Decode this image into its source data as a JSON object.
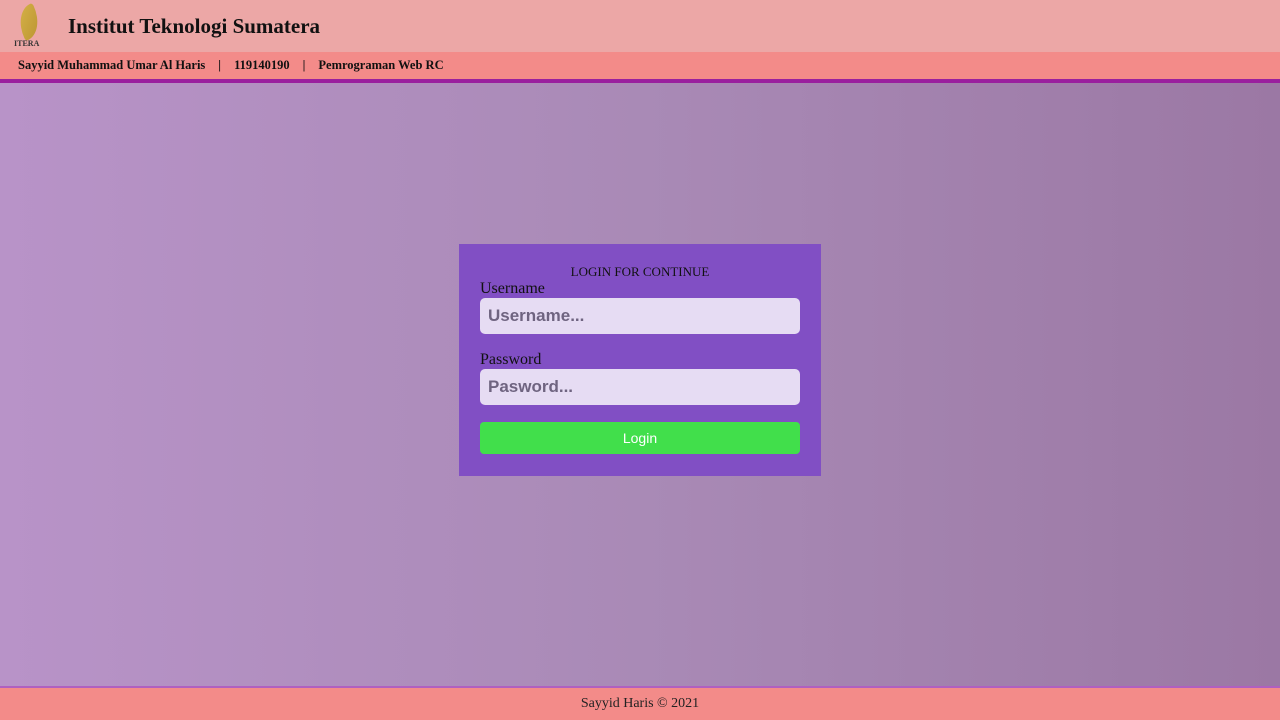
{
  "header": {
    "logo_text": "ITERA",
    "title": "Institut Teknologi Sumatera"
  },
  "subbar": {
    "name": "Sayyid Muhammad Umar Al Haris",
    "separator": "|",
    "nim": "119140190",
    "course": "Pemrograman Web RC"
  },
  "login": {
    "heading": "LOGIN FOR CONTINUE",
    "username_label": "Username",
    "username_placeholder": "Username...",
    "password_label": "Password",
    "password_placeholder": "Pasword...",
    "button_label": "Login"
  },
  "footer": {
    "text": "Sayyid Haris © 2021"
  },
  "colors": {
    "card": "#814fc4",
    "button": "#41df4b",
    "header": "#eca7a6",
    "subbar": "#f38b89"
  }
}
